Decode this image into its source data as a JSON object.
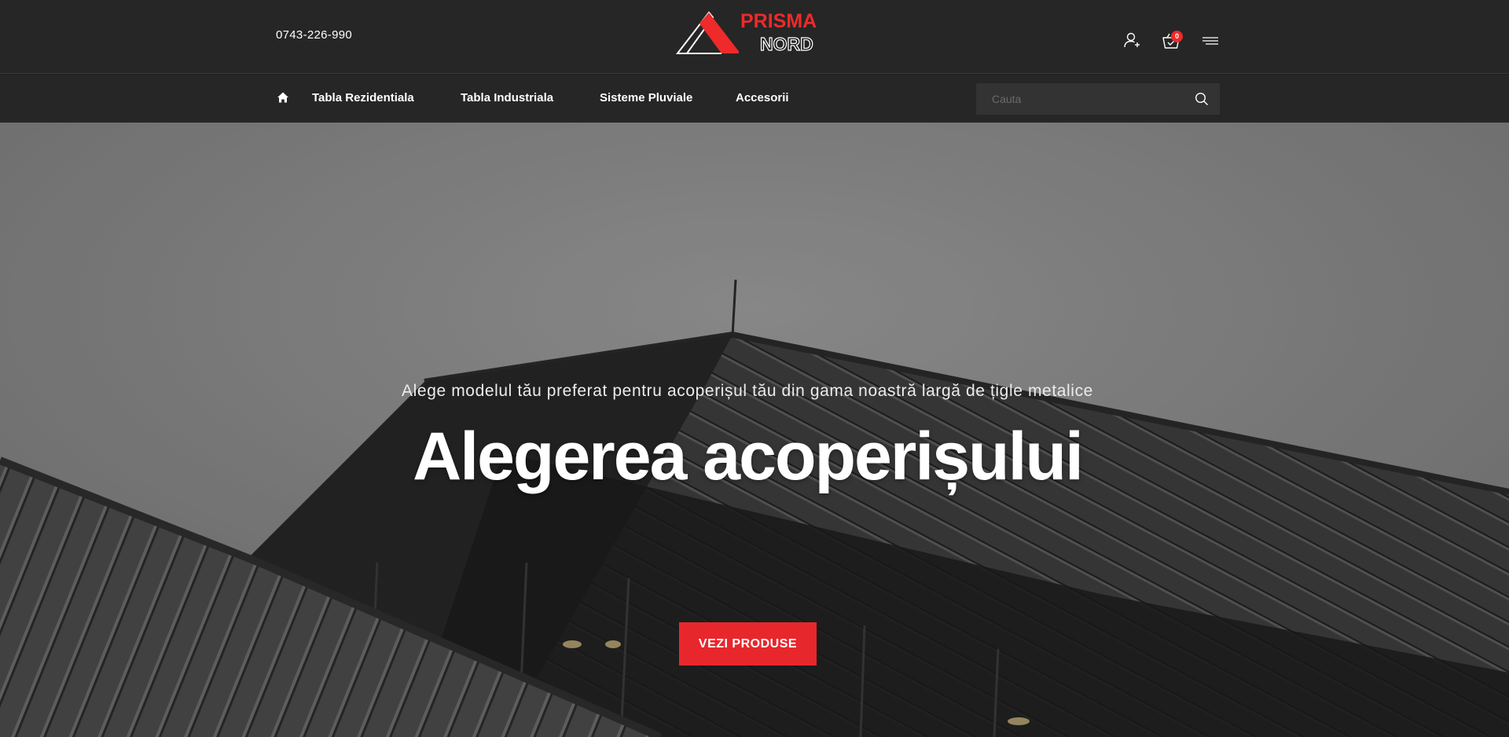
{
  "header": {
    "phone": "0743-226-990",
    "logo": {
      "line1": "PRISMA",
      "line2": "NORD"
    },
    "icons": [
      "user-icon",
      "cart-icon",
      "menu-icon"
    ],
    "cart_count": "0"
  },
  "nav": {
    "home_icon": "home-icon",
    "items": [
      {
        "label": "Tabla Rezidentiala"
      },
      {
        "label": "Tabla Industriala"
      },
      {
        "label": "Sisteme Pluviale"
      },
      {
        "label": "Accesorii"
      }
    ],
    "search": {
      "placeholder": "Cauta",
      "value": ""
    }
  },
  "hero": {
    "subtitle": "Alege modelul tău preferat pentru acoperișul tău din gama noastră largă de țigle metalice",
    "title": "Alegerea acoperișului",
    "button_label": "VEZI PRODUSE"
  },
  "colors": {
    "accent": "#e8272d",
    "header_bg": "#262626",
    "search_bg": "#333333"
  }
}
